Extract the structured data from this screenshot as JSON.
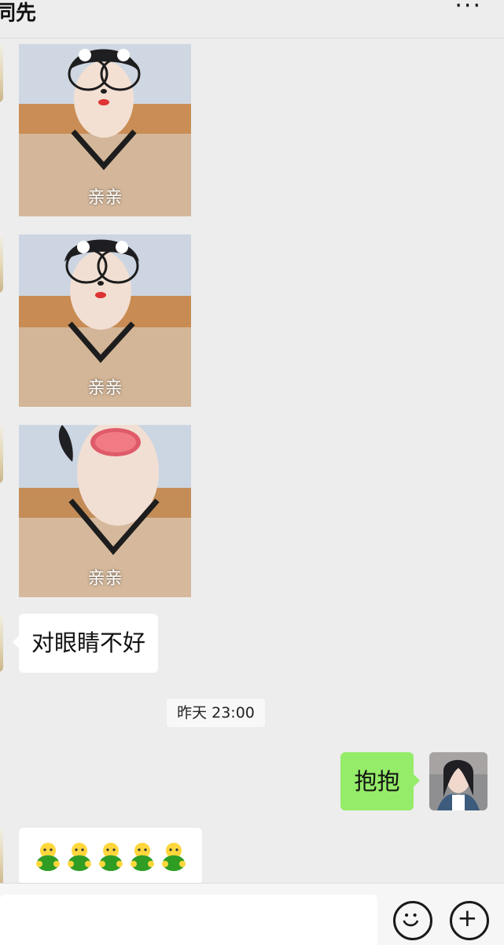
{
  "header": {
    "title": "同先",
    "more_icon": "more-icon"
  },
  "messages": {
    "stickers": [
      {
        "caption": "亲亲",
        "style": "glasses-cat"
      },
      {
        "caption": "亲亲",
        "style": "glasses-cat"
      },
      {
        "caption": "亲亲",
        "style": "kiss-lips"
      }
    ],
    "text_incoming": "对眼睛不好",
    "timestamp": "昨天 23:00",
    "text_outgoing": "抱抱",
    "emoji_row": [
      "green-doll-emoji",
      "green-doll-emoji",
      "green-doll-emoji",
      "green-doll-emoji",
      "green-doll-emoji"
    ]
  },
  "input_bar": {
    "emoji_button_icon": "smiley-icon",
    "plus_button_icon": "plus-icon"
  },
  "colors": {
    "background": "#ededed",
    "outgoing_bubble": "#95ec69",
    "incoming_bubble": "#ffffff"
  }
}
